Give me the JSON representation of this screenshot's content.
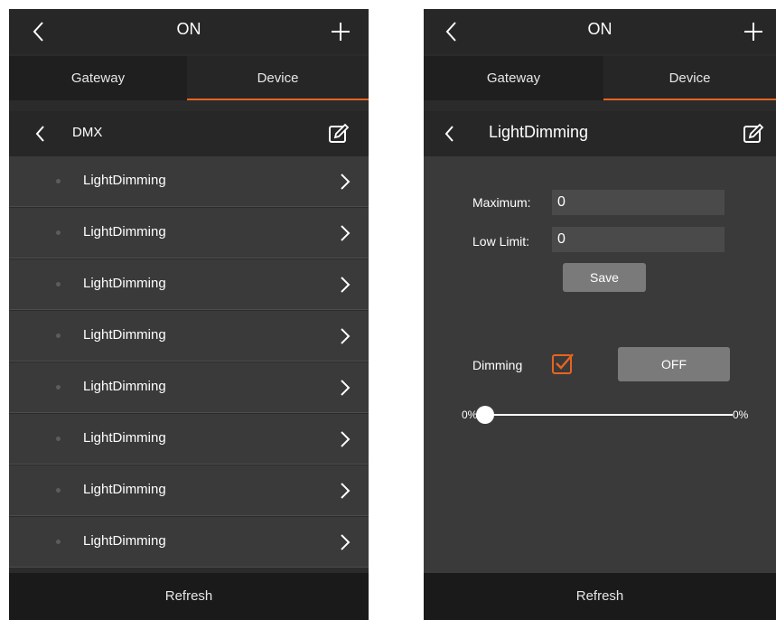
{
  "colors": {
    "accent": "#e8641f",
    "background": "#2b2b2b"
  },
  "left": {
    "header": {
      "title": "ON",
      "back_icon": "chevron-left-icon",
      "add_icon": "plus-icon"
    },
    "tabs": [
      {
        "label": "Gateway",
        "active": false
      },
      {
        "label": "Device",
        "active": true
      }
    ],
    "subheader": {
      "title": "DMX",
      "edit_icon": "edit-icon"
    },
    "items": [
      {
        "label": "LightDimming"
      },
      {
        "label": "LightDimming"
      },
      {
        "label": "LightDimming"
      },
      {
        "label": "LightDimming"
      },
      {
        "label": "LightDimming"
      },
      {
        "label": "LightDimming"
      },
      {
        "label": "LightDimming"
      },
      {
        "label": "LightDimming"
      }
    ],
    "footer": {
      "refresh_label": "Refresh"
    }
  },
  "right": {
    "header": {
      "title": "ON"
    },
    "tabs": [
      {
        "label": "Gateway",
        "active": false
      },
      {
        "label": "Device",
        "active": true
      }
    ],
    "subheader": {
      "title": "LightDimming"
    },
    "form": {
      "maximum_label": "Maximum:",
      "maximum_value": "0",
      "low_limit_label": "Low Limit:",
      "low_limit_value": "0",
      "save_label": "Save"
    },
    "dimming": {
      "label": "Dimming",
      "checked": true,
      "toggle_label": "OFF",
      "slider_min_label": "0%",
      "slider_value_label": "0%",
      "slider_value": 0
    },
    "footer": {
      "refresh_label": "Refresh"
    }
  }
}
